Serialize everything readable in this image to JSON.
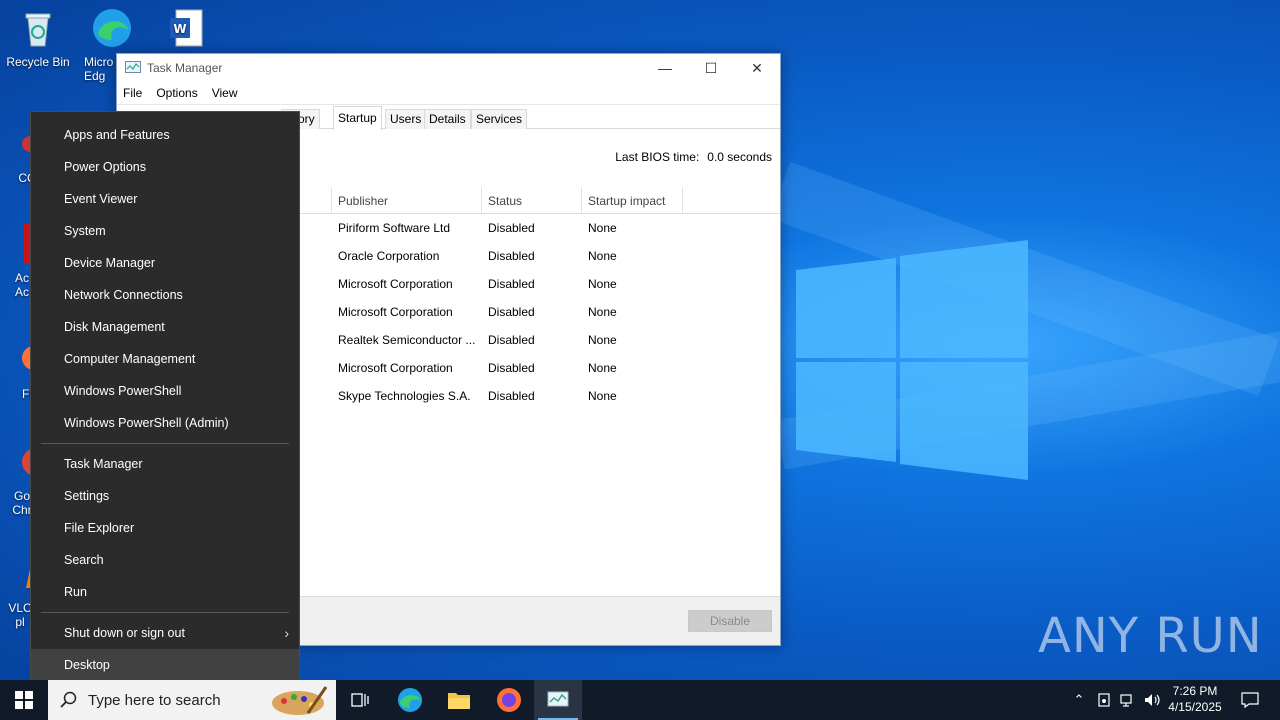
{
  "desktop": {
    "icons": [
      {
        "label": "Recycle Bin",
        "icon": "recycle-bin-icon"
      },
      {
        "label": "Micro Edg",
        "icon": "edge-icon"
      },
      {
        "label": "",
        "icon": "word-document-icon"
      },
      {
        "label": "CC",
        "icon": "ccleaner-icon"
      },
      {
        "label": "Ac Ac",
        "icon": "acrobat-icon"
      },
      {
        "label": "Fi",
        "icon": "firefox-icon"
      },
      {
        "label": "Go Chr",
        "icon": "chrome-icon"
      },
      {
        "label": "VLC pl",
        "icon": "vlc-icon"
      }
    ],
    "watermark": "ANY RUN"
  },
  "task_manager": {
    "title": "Task Manager",
    "menu": [
      "File",
      "Options",
      "View"
    ],
    "tabs": [
      "istory",
      "Startup",
      "Users",
      "Details",
      "Services"
    ],
    "active_tab": "Startup",
    "bios_label": "Last BIOS time:",
    "bios_value": "0.0 seconds",
    "columns": [
      "Publisher",
      "Status",
      "Startup impact"
    ],
    "rows": [
      {
        "publisher": "Piriform Software Ltd",
        "status": "Disabled",
        "impact": "None"
      },
      {
        "publisher": "Oracle Corporation",
        "status": "Disabled",
        "impact": "None"
      },
      {
        "publisher": "Microsoft Corporation",
        "status": "Disabled",
        "impact": "None"
      },
      {
        "publisher": "Microsoft Corporation",
        "status": "Disabled",
        "impact": "None"
      },
      {
        "publisher": "Realtek Semiconductor ...",
        "status": "Disabled",
        "impact": "None"
      },
      {
        "publisher": "Microsoft Corporation",
        "status": "Disabled",
        "impact": "None"
      },
      {
        "publisher": "Skype Technologies S.A.",
        "status": "Disabled",
        "impact": "None"
      }
    ],
    "disable_button": "Disable"
  },
  "winx_menu": {
    "items": [
      "Apps and Features",
      "Power Options",
      "Event Viewer",
      "System",
      "Device Manager",
      "Network Connections",
      "Disk Management",
      "Computer Management",
      "Windows PowerShell",
      "Windows PowerShell (Admin)",
      "Task Manager",
      "Settings",
      "File Explorer",
      "Search",
      "Run",
      "Shut down or sign out",
      "Desktop"
    ],
    "hovered": "Desktop"
  },
  "taskbar": {
    "search_placeholder": "Type here to search",
    "time": "7:26 PM",
    "date": "4/15/2025"
  },
  "colors": {
    "menu_bg": "#2b2b2b",
    "menu_hover": "#414141",
    "taskbar_bg": "#101a28",
    "desktop_blue": "#0a5bc4"
  }
}
